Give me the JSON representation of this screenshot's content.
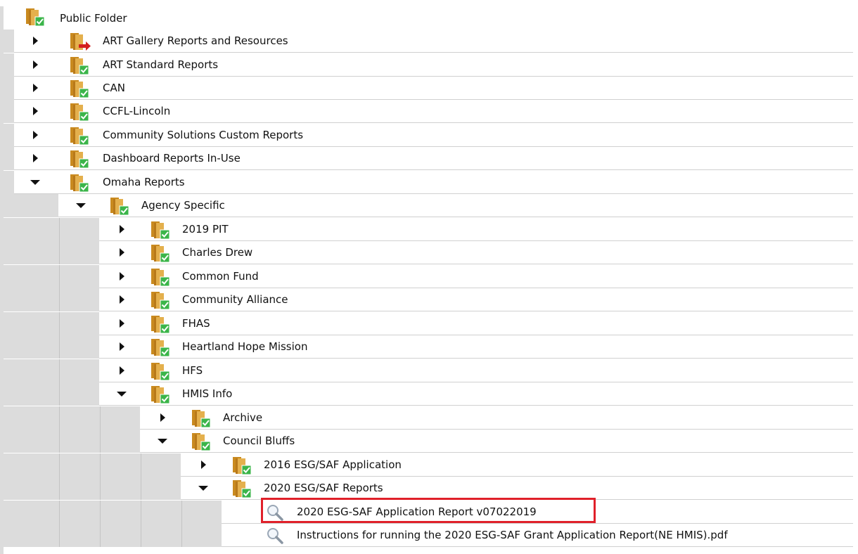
{
  "tree": {
    "root": {
      "label": "Public Folder",
      "icon": "shared-folder-icon"
    },
    "items": [
      {
        "label": "ART Gallery Reports and Resources",
        "state": "collapsed",
        "icon": "linked-folder-icon"
      },
      {
        "label": "ART Standard Reports",
        "state": "collapsed",
        "icon": "shared-folder-icon"
      },
      {
        "label": "CAN",
        "state": "collapsed",
        "icon": "shared-folder-icon"
      },
      {
        "label": "CCFL-Lincoln",
        "state": "collapsed",
        "icon": "shared-folder-icon"
      },
      {
        "label": "Community Solutions Custom Reports",
        "state": "collapsed",
        "icon": "shared-folder-icon"
      },
      {
        "label": "Dashboard Reports In-Use",
        "state": "collapsed",
        "icon": "shared-folder-icon"
      },
      {
        "label": "Omaha Reports",
        "state": "expanded",
        "icon": "shared-folder-icon"
      },
      {
        "label": "Agency Specific",
        "state": "expanded",
        "icon": "shared-folder-icon"
      },
      {
        "label": "2019 PIT",
        "state": "collapsed",
        "icon": "shared-folder-icon"
      },
      {
        "label": "Charles Drew",
        "state": "collapsed",
        "icon": "shared-folder-icon"
      },
      {
        "label": "Common Fund",
        "state": "collapsed",
        "icon": "shared-folder-icon"
      },
      {
        "label": "Community Alliance",
        "state": "collapsed",
        "icon": "shared-folder-icon"
      },
      {
        "label": "FHAS",
        "state": "collapsed",
        "icon": "shared-folder-icon"
      },
      {
        "label": "Heartland Hope Mission",
        "state": "collapsed",
        "icon": "shared-folder-icon"
      },
      {
        "label": "HFS",
        "state": "collapsed",
        "icon": "shared-folder-icon"
      },
      {
        "label": "HMIS Info",
        "state": "expanded",
        "icon": "shared-folder-icon"
      },
      {
        "label": "Archive",
        "state": "collapsed",
        "icon": "shared-folder-icon"
      },
      {
        "label": "Council Bluffs",
        "state": "expanded",
        "icon": "shared-folder-icon"
      },
      {
        "label": "2016 ESG/SAF Application",
        "state": "collapsed",
        "icon": "shared-folder-icon"
      },
      {
        "label": "2020 ESG/SAF Reports",
        "state": "expanded",
        "icon": "shared-folder-icon"
      },
      {
        "label": "2020 ESG-SAF Application Report v07022019",
        "state": "leaf",
        "icon": "report-magnifier-icon",
        "highlighted": true
      },
      {
        "label": "Instructions for running the 2020 ESG-SAF Grant Application Report(NE HMIS).pdf",
        "state": "leaf",
        "icon": "report-magnifier-icon"
      }
    ]
  },
  "colors": {
    "gutter": "#dcdcdc",
    "highlight": "#e0202a",
    "folder": "#d9a441",
    "check": "#3bb54a",
    "link_arrow": "#d31f1f"
  }
}
